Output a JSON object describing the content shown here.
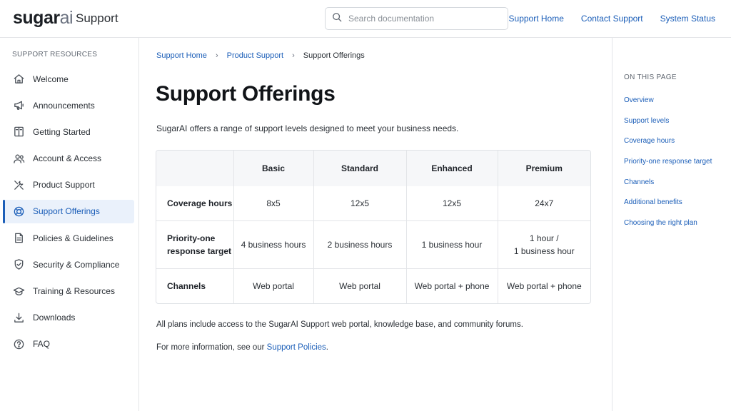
{
  "header": {
    "logo_main": "sugar",
    "logo_ai": "ai",
    "logo_sub": "Support",
    "search_placeholder": "Search documentation",
    "links": [
      "Support Home",
      "Contact Support",
      "System Status"
    ]
  },
  "sidebar": {
    "title": "SUPPORT RESOURCES",
    "items": [
      {
        "label": "Welcome",
        "icon": "home-icon"
      },
      {
        "label": "Announcements",
        "icon": "megaphone-icon"
      },
      {
        "label": "Getting Started",
        "icon": "book-icon"
      },
      {
        "label": "Account & Access",
        "icon": "users-icon"
      },
      {
        "label": "Product Support",
        "icon": "tools-icon"
      },
      {
        "label": "Support Offerings",
        "icon": "lifebuoy-icon",
        "active": true
      },
      {
        "label": "Policies & Guidelines",
        "icon": "document-icon"
      },
      {
        "label": "Security & Compliance",
        "icon": "shield-icon"
      },
      {
        "label": "Training & Resources",
        "icon": "graduation-cap-icon"
      },
      {
        "label": "Downloads",
        "icon": "download-icon"
      },
      {
        "label": "FAQ",
        "icon": "help-circle-icon"
      }
    ]
  },
  "breadcrumb": {
    "items": [
      "Support Home",
      "Product Support"
    ],
    "current": "Support Offerings"
  },
  "main": {
    "title": "Support Offerings",
    "intro": "SugarAI offers a range of support levels designed to meet your business needs.",
    "table": {
      "corner": "",
      "columns": [
        "Basic",
        "Standard",
        "Enhanced",
        "Premium"
      ],
      "rows": [
        {
          "label": "Coverage hours",
          "cells": [
            "8x5",
            "12x5",
            "12x5",
            "24x7"
          ]
        },
        {
          "label_line1": "Priority-one",
          "label_line2": "response target",
          "cells": [
            "4 business hours",
            "2 business hours",
            "1 business hour"
          ],
          "last_line1": "1 hour /",
          "last_line2": "1 business hour"
        },
        {
          "label": "Channels",
          "cells": [
            "Web portal",
            "Web portal",
            "Web portal + phone",
            "Web portal + phone"
          ]
        }
      ]
    },
    "note1": "All plans include access to the SugarAI Support web portal, knowledge base, and community forums.",
    "note2_prefix": "For more information, see our ",
    "note2_link": "Support Policies",
    "note2_suffix": "."
  },
  "toc": {
    "title": "ON THIS PAGE",
    "items": [
      "Overview",
      "Support levels",
      "Coverage hours",
      "Priority-one response target",
      "Channels",
      "Additional benefits",
      "Choosing the right plan"
    ]
  },
  "colors": {
    "accent": "#1b5eb8",
    "active_bg": "#eaf1fb",
    "border": "#e3e5e8"
  }
}
